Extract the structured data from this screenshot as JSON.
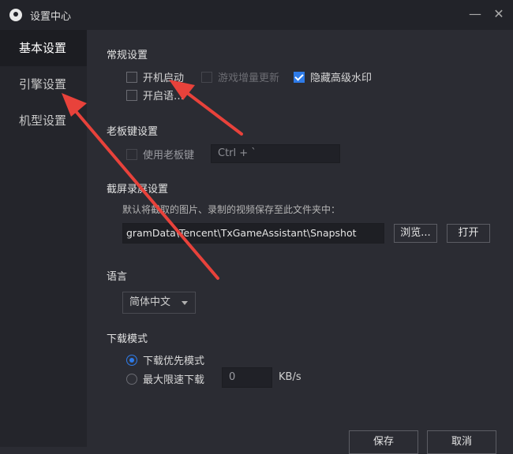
{
  "window": {
    "title": "设置中心",
    "minimize_glyph": "—",
    "close_glyph": "✕"
  },
  "sidebar": {
    "items": [
      {
        "label": "基本设置",
        "active": true
      },
      {
        "label": "引擎设置",
        "active": false
      },
      {
        "label": "机型设置",
        "active": false
      }
    ]
  },
  "general": {
    "title": "常规设置",
    "autostart": {
      "label": "开机启动",
      "checked": false
    },
    "incremental_update": {
      "label": "游戏增量更新",
      "checked": false,
      "disabled": true
    },
    "hide_watermark": {
      "label": "隐藏高级水印",
      "checked": true
    },
    "hidden_option": {
      "label": "开启语…",
      "checked": false
    }
  },
  "boss_key": {
    "title": "老板键设置",
    "enable": {
      "label": "使用老板键",
      "checked": false,
      "disabled": true
    },
    "shortcut_value": "Ctrl + `"
  },
  "screenshot": {
    "title": "截屏录屏设置",
    "description": "默认将截取的图片、录制的视频保存至此文件夹中：",
    "path_value": "gramData\\Tencent\\TxGameAssistant\\Snapshot",
    "browse_label": "浏览...",
    "open_label": "打开"
  },
  "language": {
    "title": "语言",
    "selected": "简体中文"
  },
  "download": {
    "title": "下载模式",
    "priority": {
      "label": "下载优先模式",
      "selected": true
    },
    "speed_limit": {
      "label": "最大限速下载",
      "selected": false
    },
    "limit_value": "0",
    "unit": "KB/s"
  },
  "footer": {
    "save_label": "保存",
    "cancel_label": "取消"
  },
  "colors": {
    "accent": "#2e7be8",
    "annotation": "#e8423b",
    "background": "#2b2c33",
    "sidebar": "#24252b"
  }
}
